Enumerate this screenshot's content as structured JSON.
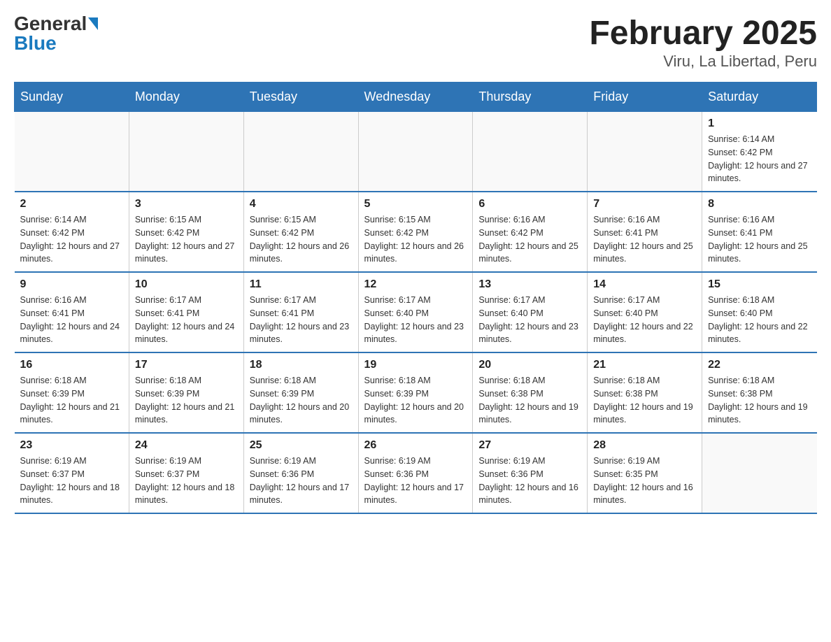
{
  "header": {
    "logo_general": "General",
    "logo_blue": "Blue",
    "title": "February 2025",
    "subtitle": "Viru, La Libertad, Peru"
  },
  "days_of_week": [
    "Sunday",
    "Monday",
    "Tuesday",
    "Wednesday",
    "Thursday",
    "Friday",
    "Saturday"
  ],
  "weeks": [
    [
      {
        "day": "",
        "sunrise": "",
        "sunset": "",
        "daylight": ""
      },
      {
        "day": "",
        "sunrise": "",
        "sunset": "",
        "daylight": ""
      },
      {
        "day": "",
        "sunrise": "",
        "sunset": "",
        "daylight": ""
      },
      {
        "day": "",
        "sunrise": "",
        "sunset": "",
        "daylight": ""
      },
      {
        "day": "",
        "sunrise": "",
        "sunset": "",
        "daylight": ""
      },
      {
        "day": "",
        "sunrise": "",
        "sunset": "",
        "daylight": ""
      },
      {
        "day": "1",
        "sunrise": "Sunrise: 6:14 AM",
        "sunset": "Sunset: 6:42 PM",
        "daylight": "Daylight: 12 hours and 27 minutes."
      }
    ],
    [
      {
        "day": "2",
        "sunrise": "Sunrise: 6:14 AM",
        "sunset": "Sunset: 6:42 PM",
        "daylight": "Daylight: 12 hours and 27 minutes."
      },
      {
        "day": "3",
        "sunrise": "Sunrise: 6:15 AM",
        "sunset": "Sunset: 6:42 PM",
        "daylight": "Daylight: 12 hours and 27 minutes."
      },
      {
        "day": "4",
        "sunrise": "Sunrise: 6:15 AM",
        "sunset": "Sunset: 6:42 PM",
        "daylight": "Daylight: 12 hours and 26 minutes."
      },
      {
        "day": "5",
        "sunrise": "Sunrise: 6:15 AM",
        "sunset": "Sunset: 6:42 PM",
        "daylight": "Daylight: 12 hours and 26 minutes."
      },
      {
        "day": "6",
        "sunrise": "Sunrise: 6:16 AM",
        "sunset": "Sunset: 6:42 PM",
        "daylight": "Daylight: 12 hours and 25 minutes."
      },
      {
        "day": "7",
        "sunrise": "Sunrise: 6:16 AM",
        "sunset": "Sunset: 6:41 PM",
        "daylight": "Daylight: 12 hours and 25 minutes."
      },
      {
        "day": "8",
        "sunrise": "Sunrise: 6:16 AM",
        "sunset": "Sunset: 6:41 PM",
        "daylight": "Daylight: 12 hours and 25 minutes."
      }
    ],
    [
      {
        "day": "9",
        "sunrise": "Sunrise: 6:16 AM",
        "sunset": "Sunset: 6:41 PM",
        "daylight": "Daylight: 12 hours and 24 minutes."
      },
      {
        "day": "10",
        "sunrise": "Sunrise: 6:17 AM",
        "sunset": "Sunset: 6:41 PM",
        "daylight": "Daylight: 12 hours and 24 minutes."
      },
      {
        "day": "11",
        "sunrise": "Sunrise: 6:17 AM",
        "sunset": "Sunset: 6:41 PM",
        "daylight": "Daylight: 12 hours and 23 minutes."
      },
      {
        "day": "12",
        "sunrise": "Sunrise: 6:17 AM",
        "sunset": "Sunset: 6:40 PM",
        "daylight": "Daylight: 12 hours and 23 minutes."
      },
      {
        "day": "13",
        "sunrise": "Sunrise: 6:17 AM",
        "sunset": "Sunset: 6:40 PM",
        "daylight": "Daylight: 12 hours and 23 minutes."
      },
      {
        "day": "14",
        "sunrise": "Sunrise: 6:17 AM",
        "sunset": "Sunset: 6:40 PM",
        "daylight": "Daylight: 12 hours and 22 minutes."
      },
      {
        "day": "15",
        "sunrise": "Sunrise: 6:18 AM",
        "sunset": "Sunset: 6:40 PM",
        "daylight": "Daylight: 12 hours and 22 minutes."
      }
    ],
    [
      {
        "day": "16",
        "sunrise": "Sunrise: 6:18 AM",
        "sunset": "Sunset: 6:39 PM",
        "daylight": "Daylight: 12 hours and 21 minutes."
      },
      {
        "day": "17",
        "sunrise": "Sunrise: 6:18 AM",
        "sunset": "Sunset: 6:39 PM",
        "daylight": "Daylight: 12 hours and 21 minutes."
      },
      {
        "day": "18",
        "sunrise": "Sunrise: 6:18 AM",
        "sunset": "Sunset: 6:39 PM",
        "daylight": "Daylight: 12 hours and 20 minutes."
      },
      {
        "day": "19",
        "sunrise": "Sunrise: 6:18 AM",
        "sunset": "Sunset: 6:39 PM",
        "daylight": "Daylight: 12 hours and 20 minutes."
      },
      {
        "day": "20",
        "sunrise": "Sunrise: 6:18 AM",
        "sunset": "Sunset: 6:38 PM",
        "daylight": "Daylight: 12 hours and 19 minutes."
      },
      {
        "day": "21",
        "sunrise": "Sunrise: 6:18 AM",
        "sunset": "Sunset: 6:38 PM",
        "daylight": "Daylight: 12 hours and 19 minutes."
      },
      {
        "day": "22",
        "sunrise": "Sunrise: 6:18 AM",
        "sunset": "Sunset: 6:38 PM",
        "daylight": "Daylight: 12 hours and 19 minutes."
      }
    ],
    [
      {
        "day": "23",
        "sunrise": "Sunrise: 6:19 AM",
        "sunset": "Sunset: 6:37 PM",
        "daylight": "Daylight: 12 hours and 18 minutes."
      },
      {
        "day": "24",
        "sunrise": "Sunrise: 6:19 AM",
        "sunset": "Sunset: 6:37 PM",
        "daylight": "Daylight: 12 hours and 18 minutes."
      },
      {
        "day": "25",
        "sunrise": "Sunrise: 6:19 AM",
        "sunset": "Sunset: 6:36 PM",
        "daylight": "Daylight: 12 hours and 17 minutes."
      },
      {
        "day": "26",
        "sunrise": "Sunrise: 6:19 AM",
        "sunset": "Sunset: 6:36 PM",
        "daylight": "Daylight: 12 hours and 17 minutes."
      },
      {
        "day": "27",
        "sunrise": "Sunrise: 6:19 AM",
        "sunset": "Sunset: 6:36 PM",
        "daylight": "Daylight: 12 hours and 16 minutes."
      },
      {
        "day": "28",
        "sunrise": "Sunrise: 6:19 AM",
        "sunset": "Sunset: 6:35 PM",
        "daylight": "Daylight: 12 hours and 16 minutes."
      },
      {
        "day": "",
        "sunrise": "",
        "sunset": "",
        "daylight": ""
      }
    ]
  ]
}
